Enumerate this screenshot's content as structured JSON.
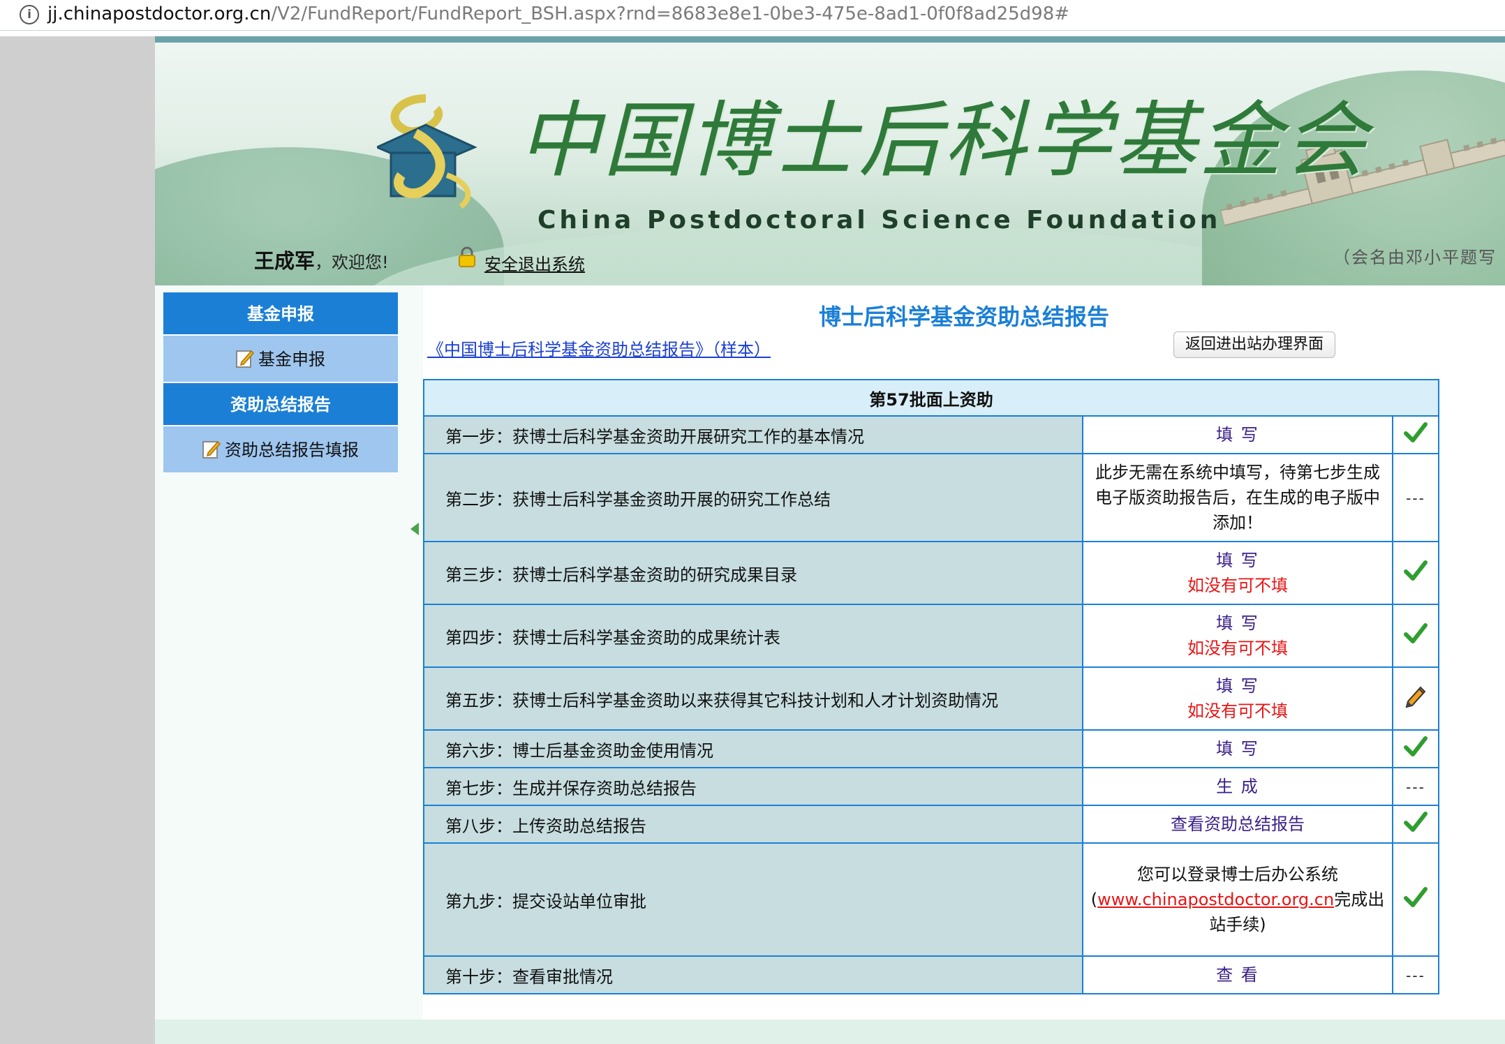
{
  "browser": {
    "url_host": "jj.chinapostdoctor.org.cn",
    "url_path": "/V2/FundReport/FundReport_BSH.aspx?rnd=8683e8e1-0be3-475e-8ad1-0f0f8ad25d98#",
    "info_icon": "info-icon"
  },
  "banner": {
    "title_cn": "中国博士后科学基金会",
    "title_en": "China Postdoctoral Science Foundation",
    "note": "（会名由邓小平题写",
    "user_name": "王成军",
    "welcome": "，欢迎您!",
    "logout": "安全退出系统"
  },
  "sidebar": {
    "sections": [
      {
        "header": "基金申报",
        "item": "基金申报"
      },
      {
        "header": "资助总结报告",
        "item": "资助总结报告填报"
      }
    ]
  },
  "main": {
    "title": "博士后科学基金资助总结报告",
    "sample_link": "《中国博士后科学基金资助总结报告》（样本）",
    "back_button": "返回进出站办理界面",
    "batch_header": "第57批面上资助",
    "steps": [
      {
        "desc": "第一步：获博士后科学基金资助开展研究工作的基本情况",
        "action": "填 写",
        "status": "check"
      },
      {
        "desc": "第二步：获博士后科学基金资助开展的研究工作总结",
        "note": "此步无需在系统中填写，待第七步生成电子版资助报告后，在生成的电子版中添加！",
        "status": "dash"
      },
      {
        "desc": "第三步：获博士后科学基金资助的研究成果目录",
        "action": "填 写",
        "optional": "如没有可不填",
        "status": "check"
      },
      {
        "desc": "第四步：获博士后科学基金资助的成果统计表",
        "action": "填 写",
        "optional": "如没有可不填",
        "status": "check"
      },
      {
        "desc": "第五步：获博士后科学基金资助以来获得其它科技计划和人才计划资助情况",
        "action": "填 写",
        "optional": "如没有可不填",
        "status": "pencil"
      },
      {
        "desc": "第六步：博士后基金资助金使用情况",
        "action": "填 写",
        "status": "check"
      },
      {
        "desc": "第七步：生成并保存资助总结报告",
        "action": "生 成",
        "status": "dash"
      },
      {
        "desc": "第八步：上传资助总结报告",
        "action": "查看资助总结报告",
        "status": "check"
      },
      {
        "desc": "第九步：提交设站单位审批",
        "note_pre": "您可以登录博士后办公系统",
        "note_open": "(",
        "note_url": "www.chinapostdoctor.org.cn",
        "note_post": "完成出站手续)",
        "status": "check"
      },
      {
        "desc": "第十步：查看审批情况",
        "action": "查 看",
        "status": "dash"
      }
    ],
    "dash_text": "---"
  },
  "colors": {
    "accent_blue": "#1b7fd6",
    "sidebar_item": "#9ec6ef",
    "row_desc_bg": "#c7dde0",
    "link_purple": "#3a1f88",
    "warn_red": "#e81414",
    "check_green": "#2f9e2f"
  }
}
